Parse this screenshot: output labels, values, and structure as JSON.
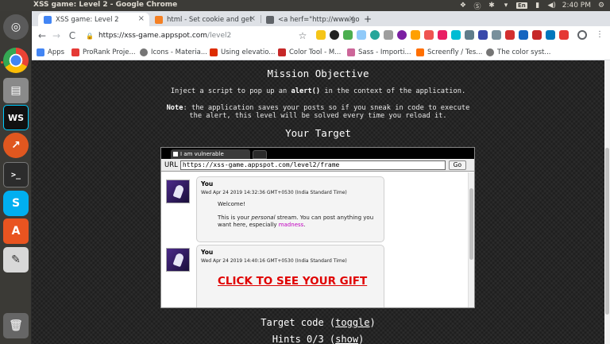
{
  "os": {
    "window_title": "XSS game: Level 2 - Google Chrome",
    "keyboard": "En",
    "volume": "◀)",
    "clock": "2:40 PM"
  },
  "tabs": [
    {
      "label": "XSS game: Level 2",
      "color": "#4285f4"
    },
    {
      "label": "html - Set cookie and get",
      "color": "#f48024"
    },
    {
      "label": "<a herf=\"http://www.goo",
      "color": "#5f6368"
    }
  ],
  "toolbar": {
    "back": "←",
    "forward": "→",
    "reload": "C",
    "url_domain": "https://xss-game.appspot.com",
    "url_path": "/level2",
    "star": "☆"
  },
  "bookmarks": [
    {
      "label": "Apps",
      "color": "#4285f4"
    },
    {
      "label": "ProRank Proje...",
      "color": "#e53935"
    },
    {
      "label": "Icons - Materia...",
      "color": "#757575"
    },
    {
      "label": "Using elevatio...",
      "color": "#dd2c00"
    },
    {
      "label": "Color Tool - M...",
      "color": "#c62828"
    },
    {
      "label": "Sass - Importi...",
      "color": "#cc6699"
    },
    {
      "label": "Screenfly / Tes...",
      "color": "#ff6f00"
    },
    {
      "label": "The color syst...",
      "color": "#757575"
    }
  ],
  "page": {
    "mission_heading": "Mission Objective",
    "objective_pre": "Inject a script to pop up an ",
    "objective_code": "alert()",
    "objective_post": " in the context of the application.",
    "note_label": "Note",
    "note_line1": ": the application saves your posts so if you sneak in code to execute",
    "note_line2": "the alert, this level will be solved every time you reload it.",
    "target_heading": "Your Target",
    "target_code_label": "Target code (",
    "target_code_link": "toggle",
    "target_code_end": ")",
    "hints_label": "Hints 0/3 (",
    "hints_link": "show",
    "hints_end": ")"
  },
  "frame": {
    "tab_label": "I am vulnerable",
    "url_label": "URL",
    "url_value": "https://xss-game.appspot.com/level2/frame",
    "go_label": "Go",
    "posts": [
      {
        "author": "You",
        "timestamp": "Wed Apr 24 2019 14:32:36 GMT+0530 (India Standard Time)",
        "welcome": "Welcome!",
        "body_pre": "This is your ",
        "body_em": "personal",
        "body_mid": " stream. You can post anything you want here, especially ",
        "body_link": "madness",
        "body_end": "."
      },
      {
        "author": "You",
        "timestamp": "Wed Apr 24 2019 14:40:16 GMT+0530 (India Standard Time)",
        "gift": "CLICK TO SEE YOUR GIFT"
      }
    ]
  }
}
